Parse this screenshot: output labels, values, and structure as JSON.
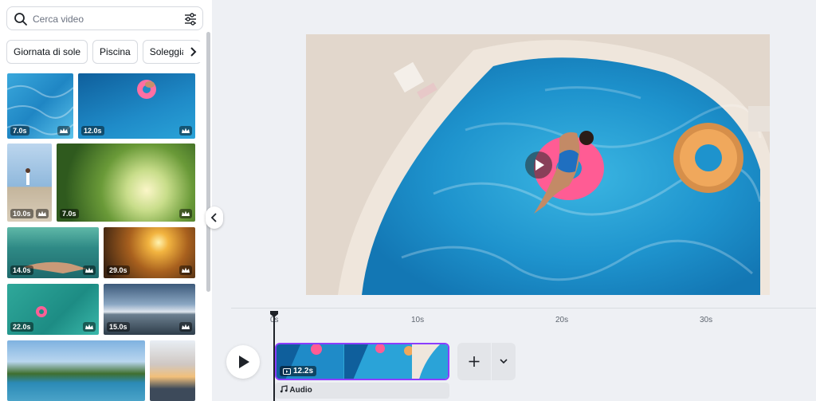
{
  "search": {
    "placeholder": "Cerca video"
  },
  "chips": [
    "Giornata di sole",
    "Piscina",
    "Soleggiato"
  ],
  "thumbnails": [
    {
      "duration": "7.0s",
      "premium": true
    },
    {
      "duration": "12.0s",
      "premium": true
    },
    {
      "duration": "10.0s",
      "premium": true
    },
    {
      "duration": "7.0s",
      "premium": true
    },
    {
      "duration": "14.0s",
      "premium": true
    },
    {
      "duration": "29.0s",
      "premium": true
    },
    {
      "duration": "22.0s",
      "premium": true
    },
    {
      "duration": "15.0s",
      "premium": true
    },
    {
      "duration": "",
      "premium": false
    },
    {
      "duration": "",
      "premium": false
    }
  ],
  "timeline": {
    "ticks": [
      "0s",
      "10s",
      "20s",
      "30s"
    ],
    "clip_duration": "12.2s",
    "audio_label": "Audio"
  },
  "colors": {
    "accent": "#8b3dff",
    "pool": "#2fa6d4"
  }
}
